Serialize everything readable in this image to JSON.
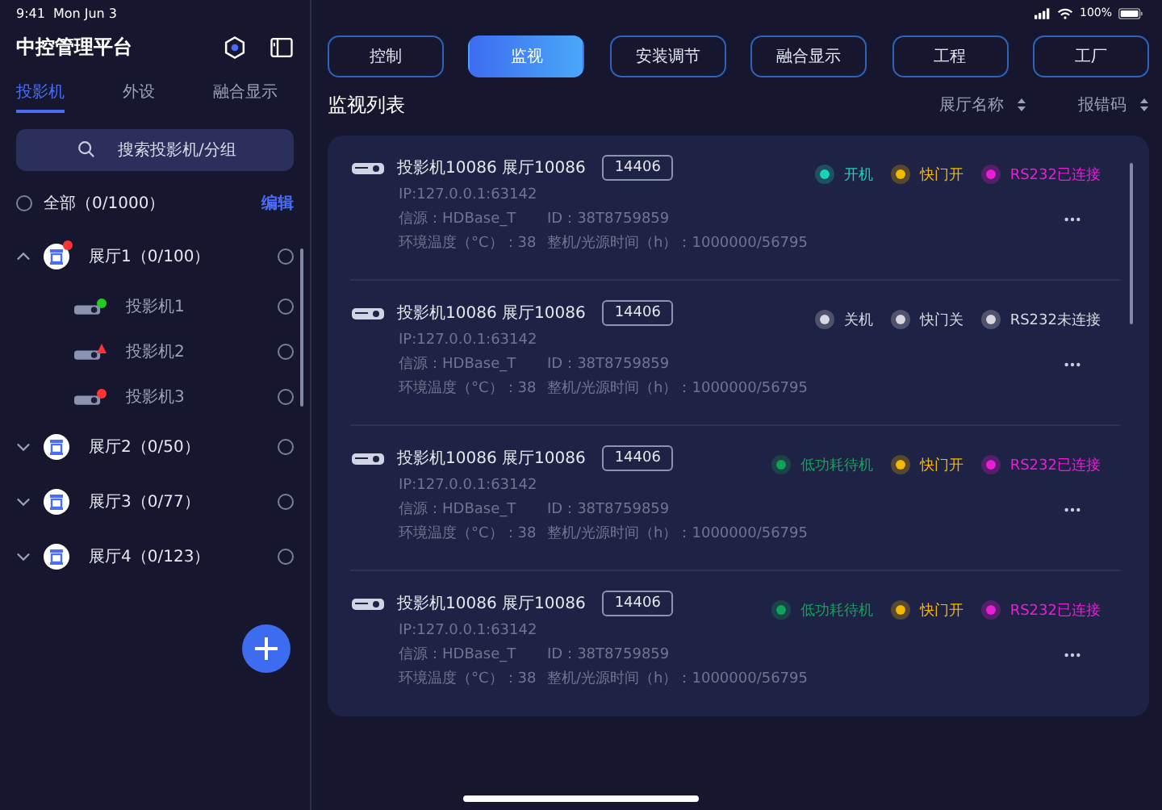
{
  "status_bar": {
    "time": "9:41",
    "date": "Mon Jun 3",
    "battery": "100%"
  },
  "sidebar": {
    "title": "中控管理平台",
    "tabs": [
      {
        "label": "投影机",
        "selected": true
      },
      {
        "label": "外设",
        "selected": false
      },
      {
        "label": "融合显示",
        "selected": false
      }
    ],
    "search": {
      "placeholder": "搜索投影机/分组"
    },
    "all": {
      "label": "全部（0/1000）",
      "checked": false
    },
    "edit": "编辑",
    "halls": [
      {
        "label": "展厅1（0/100）",
        "expanded": true,
        "alert": true,
        "checked": false,
        "children": [
          {
            "label": "投影机1",
            "checked": false,
            "kind": "dot",
            "color": "#22cc22"
          },
          {
            "label": "投影机2",
            "checked": false,
            "kind": "warning",
            "color": "#ff3333"
          },
          {
            "label": "投影机3",
            "checked": false,
            "kind": "dot",
            "color": "#ff3333"
          }
        ]
      },
      {
        "label": "展厅2（0/50）",
        "expanded": false,
        "alert": false,
        "checked": false
      },
      {
        "label": "展厅3（0/77）",
        "expanded": false,
        "alert": false,
        "checked": false
      },
      {
        "label": "展厅4（0/123）",
        "expanded": false,
        "alert": false,
        "checked": false
      }
    ]
  },
  "nav": [
    {
      "label": "控制",
      "selected": false
    },
    {
      "label": "监视",
      "selected": true
    },
    {
      "label": "安装调节",
      "selected": false
    },
    {
      "label": "融合显示",
      "selected": false
    },
    {
      "label": "工程",
      "selected": false
    },
    {
      "label": "工厂",
      "selected": false
    }
  ],
  "list": {
    "title": "监视列表",
    "sorts": [
      "展厅名称",
      "报错码"
    ],
    "rows": [
      {
        "name": "投影机10086 展厅10086",
        "code": "14406",
        "ip": "IP:127.0.0.1:63142",
        "source": "信源：HDBase_T",
        "id": "ID：38T8759859",
        "temp": "环境温度（°C）：38",
        "hours": "整机/光源时间（h）：1000000/56795",
        "statuses": [
          {
            "label": "开机",
            "color": "#19d3b4"
          },
          {
            "label": "快门开",
            "color": "#f5b800"
          },
          {
            "label": "RS232已连接",
            "color": "#e81ed6"
          }
        ]
      },
      {
        "name": "投影机10086 展厅10086",
        "code": "14406",
        "ip": "IP:127.0.0.1:63142",
        "source": "信源：HDBase_T",
        "id": "ID：38T8759859",
        "temp": "环境温度（°C）：38",
        "hours": "整机/光源时间（h）：1000000/56795",
        "statuses": [
          {
            "label": "关机",
            "color": "#d8d8e0"
          },
          {
            "label": "快门关",
            "color": "#d8d8e0"
          },
          {
            "label": "RS232未连接",
            "color": "#d8d8e0"
          }
        ]
      },
      {
        "name": "投影机10086 展厅10086",
        "code": "14406",
        "ip": "IP:127.0.0.1:63142",
        "source": "信源：HDBase_T",
        "id": "ID：38T8759859",
        "temp": "环境温度（°C）：38",
        "hours": "整机/光源时间（h）：1000000/56795",
        "statuses": [
          {
            "label": "低功耗待机",
            "color": "#12a25c"
          },
          {
            "label": "快门开",
            "color": "#f5b800"
          },
          {
            "label": "RS232已连接",
            "color": "#e81ed6"
          }
        ]
      },
      {
        "name": "投影机10086 展厅10086",
        "code": "14406",
        "ip": "IP:127.0.0.1:63142",
        "source": "信源：HDBase_T",
        "id": "ID：38T8759859",
        "temp": "环境温度（°C）：38",
        "hours": "整机/光源时间（h）：1000000/56795",
        "statuses": [
          {
            "label": "低功耗待机",
            "color": "#12a25c"
          },
          {
            "label": "快门开",
            "color": "#f5b800"
          },
          {
            "label": "RS232已连接",
            "color": "#e81ed6"
          }
        ]
      }
    ]
  }
}
